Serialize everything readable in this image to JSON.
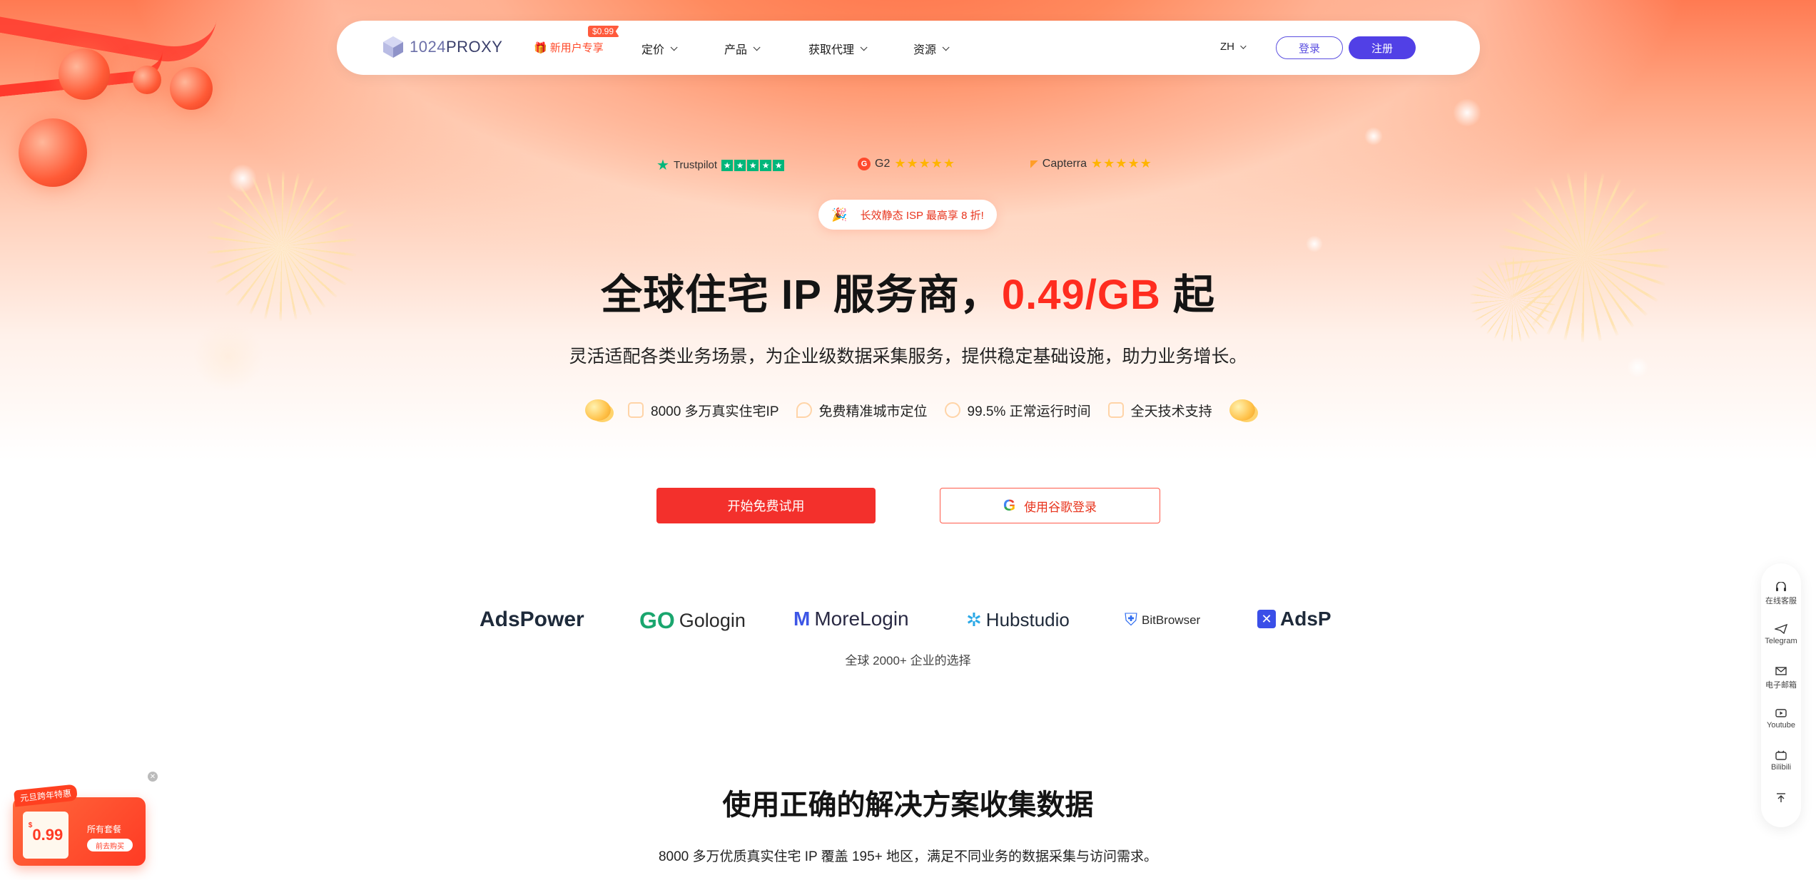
{
  "nav": {
    "logo_text_bold": "1024",
    "logo_text": "PROXY",
    "new_user_promo": "新用户专享",
    "new_user_badge": "$0.99",
    "items": [
      {
        "label": "定价"
      },
      {
        "label": "产品"
      },
      {
        "label": "获取代理"
      },
      {
        "label": "资源"
      }
    ],
    "lang": "ZH",
    "login": "登录",
    "register": "注册"
  },
  "ratings": {
    "trustpilot": "Trustpilot",
    "g2": "G2",
    "capterra": "Capterra",
    "stars": "★★★★★"
  },
  "promo_pill": "长效静态 ISP 最高享 8 折!",
  "hero": {
    "headline_pre": "全球住宅 IP 服务商，",
    "headline_accent": "0.49/GB",
    "headline_post": " 起",
    "subline": "灵活适配各类业务场景，为企业级数据采集服务，提供稳定基础设施，助力业务增长。",
    "features": [
      {
        "label": "8000 多万真实住宅IP",
        "icon": "home-icon"
      },
      {
        "label": "免费精准城市定位",
        "icon": "location-icon"
      },
      {
        "label": "99.5% 正常运行时间",
        "icon": "clock-icon"
      },
      {
        "label": "全天技术支持",
        "icon": "phone-icon"
      }
    ],
    "cta_primary": "开始免费试用",
    "cta_google": "使用谷歌登录"
  },
  "partners": {
    "logos": [
      "AdsPower",
      "Gologin",
      "MoreLogin",
      "Hubstudio",
      "BitBrowser",
      "AdsP"
    ],
    "caption": "全球 2000+ 企业的选择"
  },
  "section": {
    "title": "使用正确的解决方案收集数据",
    "subtitle": "8000 多万优质真实住宅 IP 覆盖 195+ 地区，满足不同业务的数据采集与访问需求。"
  },
  "sidebar": [
    {
      "label": "在线客服",
      "icon": "headset-icon"
    },
    {
      "label": "Telegram",
      "icon": "telegram-icon"
    },
    {
      "label": "电子邮箱",
      "icon": "mail-icon"
    },
    {
      "label": "Youtube",
      "icon": "youtube-icon"
    },
    {
      "label": "Bilibili",
      "icon": "bilibili-icon"
    },
    {
      "label": "",
      "icon": "back-to-top-icon"
    }
  ],
  "promo_card": {
    "tag": "元旦跨年特惠",
    "price": "0.99",
    "currency": "$",
    "all": "所有套餐",
    "buy": "前去购买"
  },
  "colors": {
    "brand_purple": "#5140e6",
    "accent_red": "#ff2c1f",
    "cta_red": "#f3302c"
  }
}
